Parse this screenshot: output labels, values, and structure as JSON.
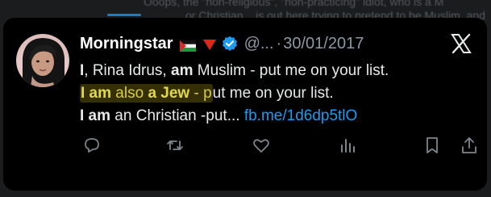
{
  "background": {
    "line1": "Ooops, the \"non-religious\", \"non-practicing\" idiot, who is a M",
    "line2": "or Christian... is out here trying to pretend to be Muslim, and"
  },
  "tweet": {
    "author_name": "Morningstar",
    "handle": "@...",
    "separator": "·",
    "date": "30/01/2017",
    "lines": [
      {
        "p1_bold": "I",
        "p2": ", Rina Idrus, ",
        "p3_bold": "am",
        "p4": " Muslim - put me on your list."
      },
      {
        "p1_bold": "I am",
        "p2": " also ",
        "p3_bold": "a Jew",
        "p4": " - put me on your list."
      },
      {
        "p1_bold": "I am",
        "p2": " an Christian -put... ",
        "link": "fb.me/1d6dp5tlO"
      }
    ]
  },
  "icons": {
    "flag": "palestine-flag-icon",
    "triangle": "red-triangle-icon",
    "verified": "verified-badge-icon",
    "close": "x-logo-icon",
    "reply": "reply-icon",
    "retweet": "retweet-icon",
    "like": "like-icon",
    "views": "views-icon",
    "bookmark": "bookmark-icon",
    "share": "share-icon"
  },
  "colors": {
    "card_bg": "#000000",
    "page_bg": "#1a1c1e",
    "text": "#e7e9ea",
    "muted": "#8b98a5",
    "link": "#1d9bf0",
    "highlight": "#d7cf3a",
    "verified": "#1d9bf0"
  }
}
